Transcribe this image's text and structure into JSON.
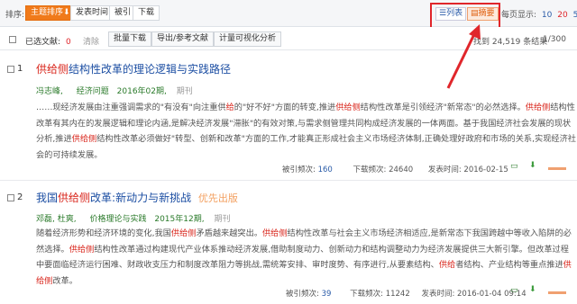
{
  "sort": {
    "label": "排序:",
    "buttons": [
      "主题排序",
      "发表时间",
      "被引",
      "下载"
    ],
    "active_arrow": "⬇"
  },
  "view": {
    "list": "列表",
    "abstract": "摘要"
  },
  "perpage": {
    "label": "每页显示:",
    "options": [
      "10",
      "20",
      "50"
    ]
  },
  "toolbar": {
    "selected_label": "已选文献:",
    "selected_count": "0",
    "clear": "清除",
    "batch_download": "批量下载",
    "export": "导出/参考文献",
    "visualize": "计量可视化分析",
    "result_count": "找到 24,519 条结果",
    "result_prefix": "找到",
    "page": "1/300"
  },
  "results": [
    {
      "index": "1",
      "title_parts": [
        {
          "t": "供给侧",
          "hl": true
        },
        {
          "t": "结构性改革的理论逻辑与实践路径",
          "hl": false
        }
      ],
      "author": "冯志峰,",
      "journal": "经济问题",
      "date": "2016年02期,",
      "type": "期刊",
      "tag": "",
      "abstract_parts": [
        {
          "t": "……现经济发展由注重强调需求的\"有没有\"向注重供",
          "hl": false
        },
        {
          "t": "给",
          "hl": true
        },
        {
          "t": "的\"好不好\"方面的转变,推进",
          "hl": false
        },
        {
          "t": "供给侧",
          "hl": true
        },
        {
          "t": "结构性改革是引领经济\"新常态\"的必然选择。",
          "hl": false
        },
        {
          "t": "供给侧",
          "hl": true
        },
        {
          "t": "结构性改革有其内在的发展逻辑和理论内涵,是解决经济发展\"滞胀\"的有效对策,与需求侧管理共同构成经济发展的一体两面。基于我国经济社会发展的现状分析,推进",
          "hl": false
        },
        {
          "t": "供给侧",
          "hl": true
        },
        {
          "t": "结构性改革必须做好\"转型、创新和改革\"方面的工作,才能真正形成社会主义市场经济体制,正确处理好政府和市场的关系,实现经济社会的可持续发展。",
          "hl": false
        }
      ],
      "cited_label": "被引频次:",
      "cited": "160",
      "download_label": "下载频次:",
      "downloads": "24640",
      "pub_label": "发表时间:",
      "pub_date": "2016-02-15"
    },
    {
      "index": "2",
      "title_parts": [
        {
          "t": "我国",
          "hl": false
        },
        {
          "t": "供给侧",
          "hl": true
        },
        {
          "t": "改革:新动力与新挑战",
          "hl": false
        }
      ],
      "author": "邓磊, 杜爽,",
      "journal": "价格理论与实践",
      "date": "2015年12期,",
      "type": "期刊",
      "tag": "优先出版",
      "abstract_parts": [
        {
          "t": "随着经济形势和经济环境的变化,我国",
          "hl": false
        },
        {
          "t": "供给侧",
          "hl": true
        },
        {
          "t": "矛盾越来越突出。",
          "hl": false
        },
        {
          "t": "供给侧",
          "hl": true
        },
        {
          "t": "结构性改革与社会主义市场经济相适应,是新常态下我国跨越中等收入陷阱的必然选择。",
          "hl": false
        },
        {
          "t": "供给侧",
          "hl": true
        },
        {
          "t": "结构性改革通过构建现代产业体系推动经济发展,借助制度动力、创新动力和结构调整动力为经济发展提供三大新引擎。但改革过程中要面临经济运行困难、财政收支压力和制度改革阻力等挑战,需统筹安排、审时度势、有序进行,从要素结构、",
          "hl": false
        },
        {
          "t": "供给",
          "hl": true
        },
        {
          "t": "者结构、产业结构等重点推进",
          "hl": false
        },
        {
          "t": "供给侧",
          "hl": true
        },
        {
          "t": "改革。",
          "hl": false
        }
      ],
      "cited_label": "被引频次:",
      "cited": "39",
      "download_label": "下载频次:",
      "downloads": "11242",
      "pub_label": "发表时间:",
      "pub_date": "2016-01-04 09:14"
    }
  ],
  "colors": {
    "accent": "#f07a1a",
    "highlight": "#d9261c",
    "link": "#1d4fa3",
    "annotation": "#e0262b"
  }
}
